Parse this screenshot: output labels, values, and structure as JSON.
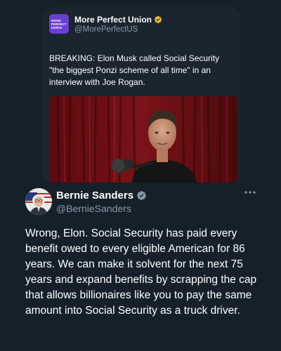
{
  "quoted_tweet": {
    "logo_lines": [
      "MORE",
      "PERFECT",
      "UNION"
    ],
    "author_name": "More Perfect Union",
    "author_handle": "@MorePerfectUS",
    "text": "BREAKING: Elon Musk called Social Security \"the biggest Ponzi scheme of all time\" in an interview with Joe Rogan.",
    "verified_icon": "verified-badge-icon"
  },
  "tweet": {
    "author_name": "Bernie Sanders",
    "author_handle": "@BernieSanders",
    "text": "Wrong, Elon. Social Security has paid every benefit owed to every eligible American for 86 years. We can make it solvent for the next 75 years and expand benefits by scrapping the cap that allows billionaires like you to pay the same amount into Social Security as a truck driver.",
    "verified_icon": "verified-badge-icon",
    "more_icon": "more-options-icon"
  },
  "colors": {
    "background": "#15202b",
    "secondary_text": "#8b98a5",
    "verified": "#e8b339",
    "brand_logo": "#6a3fd0"
  }
}
